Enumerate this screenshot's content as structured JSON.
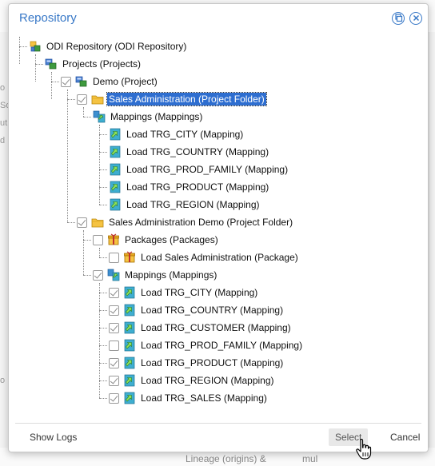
{
  "background": {
    "left_fragments": [
      "",
      "o",
      "So",
      "ut",
      "d",
      "",
      "o"
    ],
    "bottom_text": "Lineage (origins) &",
    "bottom_text2": "mul"
  },
  "dialog": {
    "title": "Repository",
    "restore_icon": "restore-icon",
    "close_icon": "close-icon"
  },
  "tree": {
    "nodes": [
      {
        "label": "ODI Repository (ODI Repository)",
        "icon": "repository-icon",
        "checkbox": "none"
      },
      {
        "label": "Projects (Projects)",
        "icon": "projects-icon",
        "checkbox": "none"
      },
      {
        "label": "Demo (Project)",
        "icon": "project-icon",
        "checkbox": "checked"
      },
      {
        "label": "Sales Administration (Project Folder)",
        "icon": "folder-icon",
        "checkbox": "checked",
        "selected": true
      },
      {
        "label": "Mappings (Mappings)",
        "icon": "mappings-icon",
        "checkbox": "none"
      },
      {
        "label": "Load TRG_CITY (Mapping)",
        "icon": "mapping-icon",
        "checkbox": "none"
      },
      {
        "label": "Load TRG_COUNTRY (Mapping)",
        "icon": "mapping-icon",
        "checkbox": "none"
      },
      {
        "label": "Load TRG_PROD_FAMILY (Mapping)",
        "icon": "mapping-icon",
        "checkbox": "none"
      },
      {
        "label": "Load TRG_PRODUCT (Mapping)",
        "icon": "mapping-icon",
        "checkbox": "none"
      },
      {
        "label": "Load TRG_REGION (Mapping)",
        "icon": "mapping-icon",
        "checkbox": "none"
      },
      {
        "label": "Sales Administration Demo (Project Folder)",
        "icon": "folder-icon",
        "checkbox": "checked"
      },
      {
        "label": "Packages (Packages)",
        "icon": "packages-icon",
        "checkbox": "unchecked"
      },
      {
        "label": "Load Sales Administration (Package)",
        "icon": "package-icon",
        "checkbox": "unchecked"
      },
      {
        "label": "Mappings (Mappings)",
        "icon": "mappings-icon",
        "checkbox": "checked"
      },
      {
        "label": "Load TRG_CITY (Mapping)",
        "icon": "mapping-icon",
        "checkbox": "checked"
      },
      {
        "label": "Load TRG_COUNTRY (Mapping)",
        "icon": "mapping-icon",
        "checkbox": "checked"
      },
      {
        "label": "Load TRG_CUSTOMER (Mapping)",
        "icon": "mapping-icon",
        "checkbox": "checked"
      },
      {
        "label": "Load TRG_PROD_FAMILY (Mapping)",
        "icon": "mapping-icon",
        "checkbox": "unchecked"
      },
      {
        "label": "Load TRG_PRODUCT (Mapping)",
        "icon": "mapping-icon",
        "checkbox": "checked"
      },
      {
        "label": "Load TRG_REGION (Mapping)",
        "icon": "mapping-icon",
        "checkbox": "checked"
      },
      {
        "label": "Load TRG_SALES (Mapping)",
        "icon": "mapping-icon",
        "checkbox": "checked"
      }
    ]
  },
  "footer": {
    "show_logs": "Show Logs",
    "select": "Select",
    "cancel": "Cancel"
  },
  "colors": {
    "accent": "#3878c7",
    "selection": "#2e6ed0"
  }
}
